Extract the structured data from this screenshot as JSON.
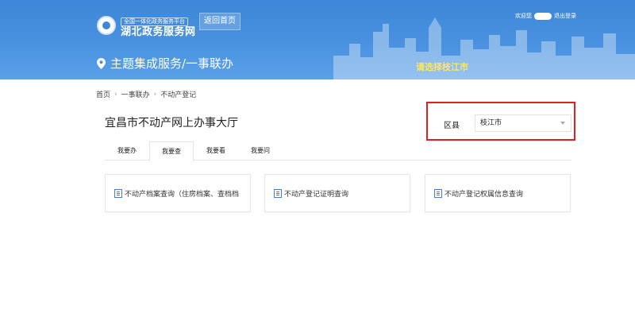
{
  "header": {
    "logo_sub": "全国一体化政务服务平台",
    "logo_main": "湖北政务服务网",
    "home_button": "返回首页",
    "welcome": "欢迎您",
    "logout": "退出登录",
    "theme_title": "主题集成服务/一事联办",
    "city_prompt": "请选择枝江市"
  },
  "breadcrumb": [
    "首页",
    "一事联办",
    "不动产登记"
  ],
  "page_title": "宜昌市不动产网上办事大厅",
  "district": {
    "label": "区县",
    "selected": "枝江市"
  },
  "tabs": [
    {
      "label": "我要办",
      "active": false
    },
    {
      "label": "我要查",
      "active": true
    },
    {
      "label": "我要看",
      "active": false
    },
    {
      "label": "我要问",
      "active": false
    }
  ],
  "cards": [
    {
      "label": "不动产档案查询（住房档案、查档档"
    },
    {
      "label": "不动产登记证明查询"
    },
    {
      "label": "不动产登记权属信息查询"
    }
  ],
  "colors": {
    "header_blue": "#4a92e0",
    "highlight_red": "#e02020",
    "prompt_yellow": "#ffe95a"
  }
}
